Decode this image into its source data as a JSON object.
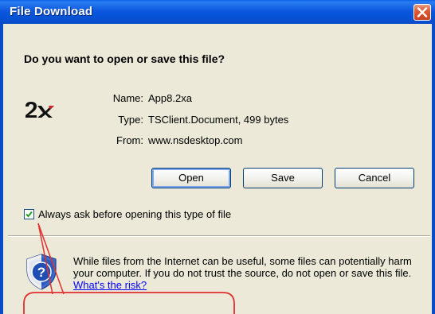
{
  "window": {
    "title": "File Download"
  },
  "dialog": {
    "question": "Do you want to open or save this file?",
    "logo_text": "2X",
    "fields": [
      {
        "label": "Name:",
        "value": "App8.2xa"
      },
      {
        "label": "Type:",
        "value": "TSClient.Document, 499 bytes"
      },
      {
        "label": "From:",
        "value": "www.nsdesktop.com"
      }
    ],
    "buttons": {
      "open": "Open",
      "save": "Save",
      "cancel": "Cancel"
    },
    "always_ask": {
      "label": "Always ask before opening this type of file",
      "checked": true
    },
    "warning": {
      "text": "While files from the Internet can be useful, some files can potentially harm your computer. If you do not trust the source, do not open or save this file.",
      "link_text": "What's the risk?"
    }
  },
  "icons": {
    "close": "close-icon",
    "logo": "2x-logo-icon",
    "shield": "security-shield-icon",
    "check": "checkmark-icon"
  },
  "colors": {
    "titlebar": "#0a58de",
    "close_button": "#de5a32",
    "annotation": "#e03030",
    "link": "#0000ff",
    "dialog_background": "#ece9d8"
  }
}
